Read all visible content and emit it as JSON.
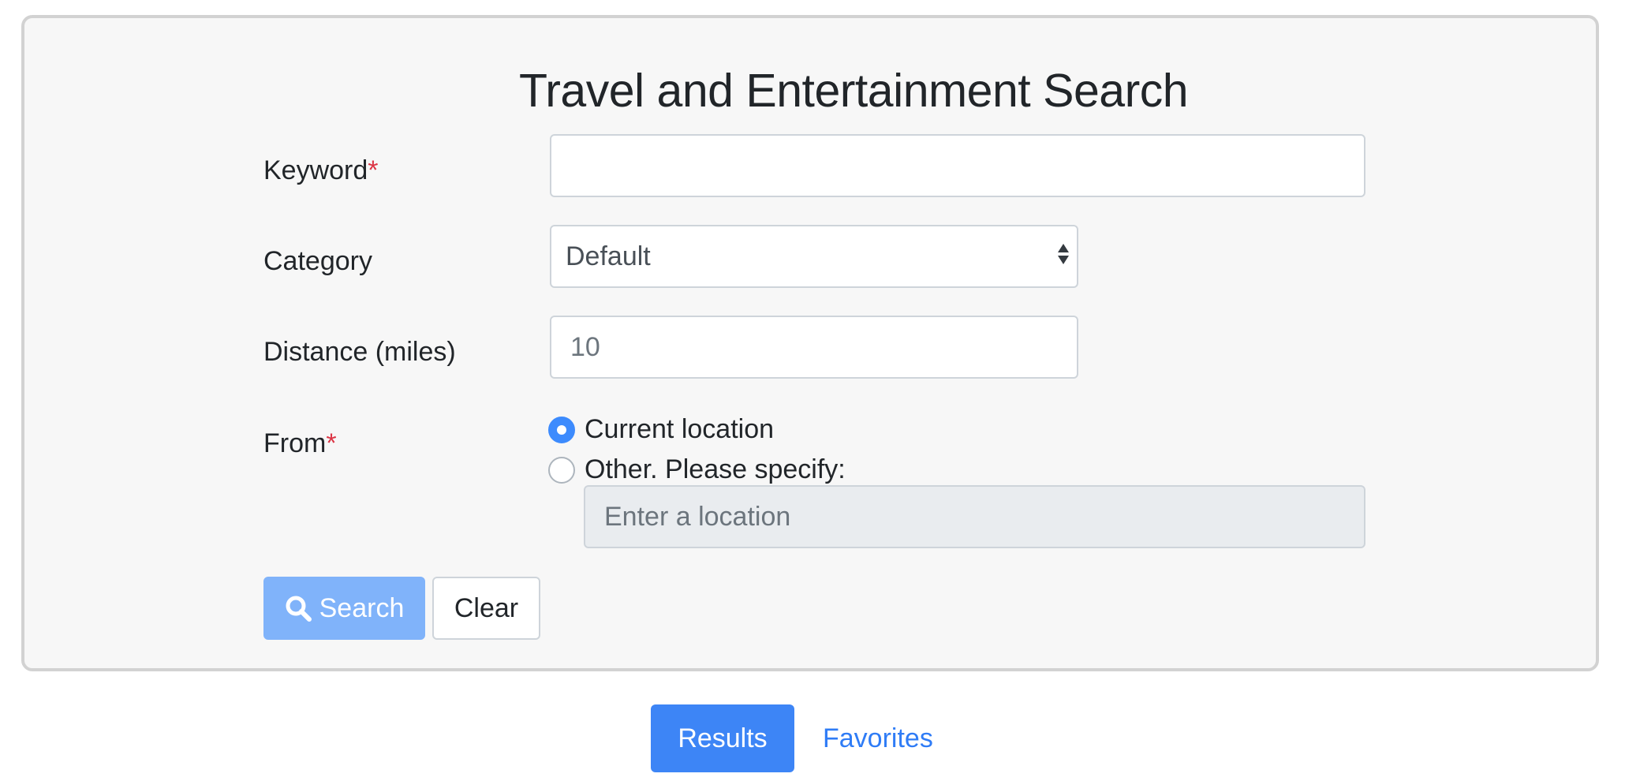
{
  "form": {
    "title": "Travel and Entertainment Search",
    "keyword_label": "Keyword",
    "required_mark": "*",
    "keyword_value": "",
    "category_label": "Category",
    "category_selected": "Default",
    "distance_label": "Distance (miles)",
    "distance_placeholder": "10",
    "from_label": "From",
    "radio_current_label": "Current location",
    "radio_other_label": "Other. Please specify:",
    "location_placeholder": "Enter a location",
    "search_button_label": "Search",
    "clear_button_label": "Clear"
  },
  "nav": {
    "results_label": "Results",
    "favorites_label": "Favorites"
  },
  "colors": {
    "primary": "#3d85f6",
    "search_button_disabled": "#80b3fa",
    "required": "#dc3545"
  },
  "icons": {
    "search_button": "search-icon",
    "category_select": "select-arrows-icon"
  }
}
